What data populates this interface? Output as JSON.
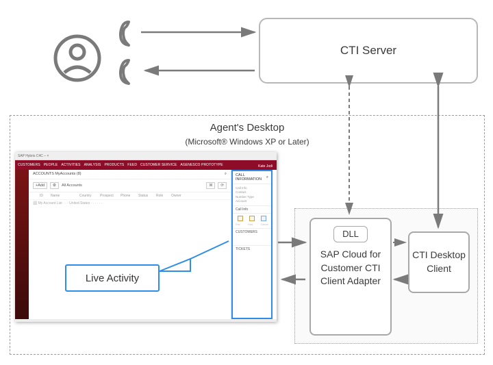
{
  "cti_server": {
    "label": "CTI Server"
  },
  "agent_desktop": {
    "title": "Agent's Desktop",
    "subtitle": "(Microsoft® Windows XP or Later)"
  },
  "live_activity": {
    "label": "Live Activity"
  },
  "adapter": {
    "dll": "DLL",
    "label": "SAP Cloud for Customer CTI Client Adapter"
  },
  "cti_client": {
    "label": "CTI Desktop Client"
  },
  "screenshot": {
    "titlebar": "SAP Hybris C4C  –  ×",
    "nav": [
      "CUSTOMERS",
      "PEOPLE",
      "ACTIVITIES",
      "ANALYSIS",
      "PRODUCTS",
      "FEED",
      "CUSTOMER SERVICE",
      "AGENESCO PROTOTYPE"
    ],
    "profile": "Kate Jodi",
    "breadcrumb": "ACCOUNTS  MyAccounts (8)",
    "breadcrumb_right": "⌕",
    "toolbar": {
      "add": "+Add",
      "config": "⚙︎",
      "filter": "All Accounts",
      "mark": "☒",
      "refresh": "⟳"
    },
    "columns": [
      "",
      "ID",
      "Name",
      "Country",
      "Prospect",
      "Phone",
      "Status",
      "Role",
      "Owner"
    ],
    "rows": [
      {
        "line": "⬜  My Account List · · · United States · · · · · ·"
      }
    ],
    "right_panel": {
      "header": "CALL INFORMATION",
      "search": "⌕",
      "lines": [
        "Call Info",
        "Contact",
        "Number Type",
        "Account"
      ],
      "mid_heading": "Call Info",
      "mid_icons": [
        "",
        "",
        ""
      ],
      "captions": [
        "End",
        "Hold",
        "Cancel"
      ],
      "customers": "CUSTOMERS",
      "tickets": "TICKETS"
    }
  }
}
